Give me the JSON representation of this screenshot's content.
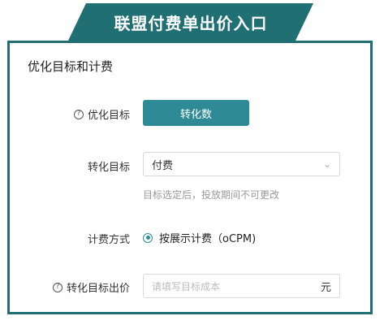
{
  "banner": {
    "title": "联盟付费单出价入口"
  },
  "card": {
    "title": "优化目标和计费",
    "optimize": {
      "label": "优化目标",
      "button": "转化数"
    },
    "conversion": {
      "label": "转化目标",
      "value": "付费",
      "hint": "目标选定后，投放期间不可更改"
    },
    "billing": {
      "label": "计费方式",
      "option": "按展示计费（oCPM)"
    },
    "bid": {
      "label": "转化目标出价",
      "placeholder": "请填写目标成本",
      "unit": "元"
    }
  },
  "colors": {
    "accent": "#1f6f73",
    "button": "#2e8b96"
  }
}
